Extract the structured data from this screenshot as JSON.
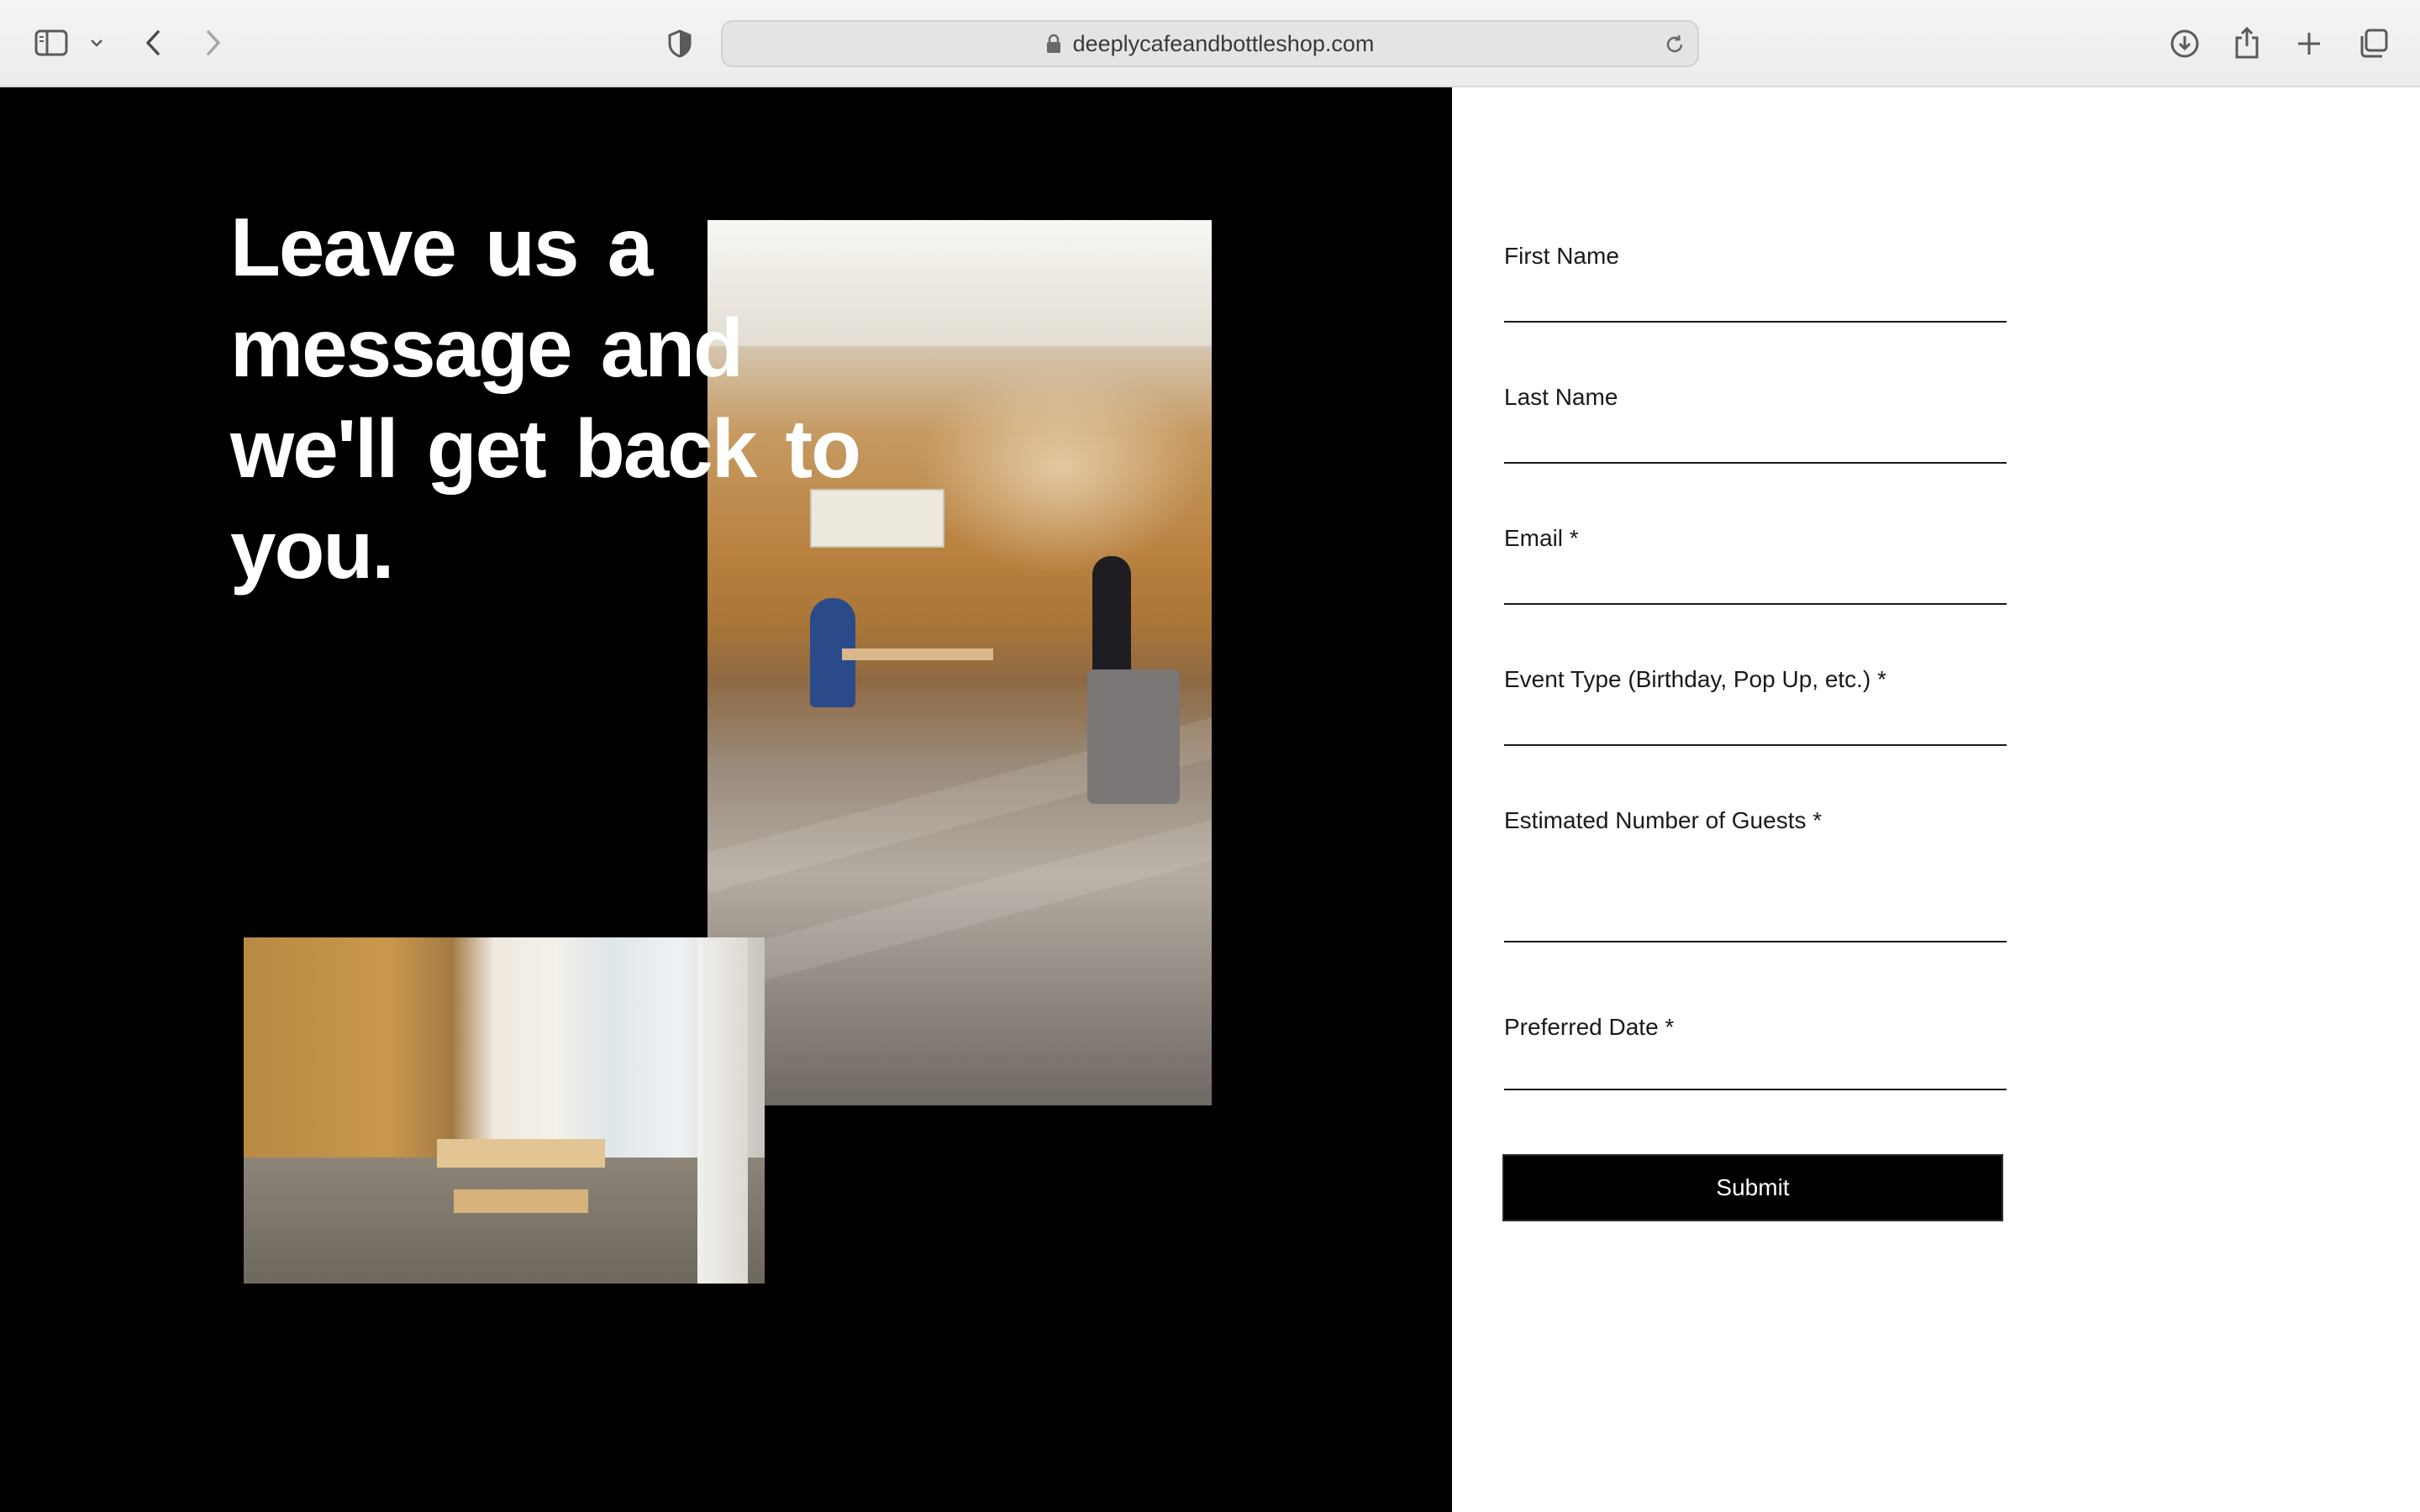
{
  "browser": {
    "url": "deeplycafeandbottleshop.com",
    "toolbar_icons": [
      "sidebar-toggle-icon",
      "chevron-down-icon",
      "back-arrow-icon",
      "forward-arrow-icon",
      "privacy-shield-icon",
      "lock-icon",
      "reload-icon",
      "download-icon",
      "share-icon",
      "new-tab-plus-icon",
      "tab-overview-icon"
    ]
  },
  "hero": {
    "headline": "Leave us a message and we'll get back to you."
  },
  "form": {
    "fields": {
      "first_name": {
        "label": "First Name",
        "value": ""
      },
      "last_name": {
        "label": "Last Name",
        "value": ""
      },
      "email": {
        "label": "Email *",
        "value": ""
      },
      "event_type": {
        "label": "Event Type (Birthday, Pop Up, etc.) *",
        "value": ""
      },
      "guests": {
        "label": "Estimated Number of Guests *",
        "value": ""
      },
      "preferred_date": {
        "label": "Preferred Date *",
        "value": ""
      }
    },
    "submit_label": "Submit"
  },
  "colors": {
    "left_background": "#000000",
    "right_background": "#ffffff",
    "headline_text": "#ffffff",
    "button_background": "#000000",
    "button_text": "#ffffff"
  }
}
